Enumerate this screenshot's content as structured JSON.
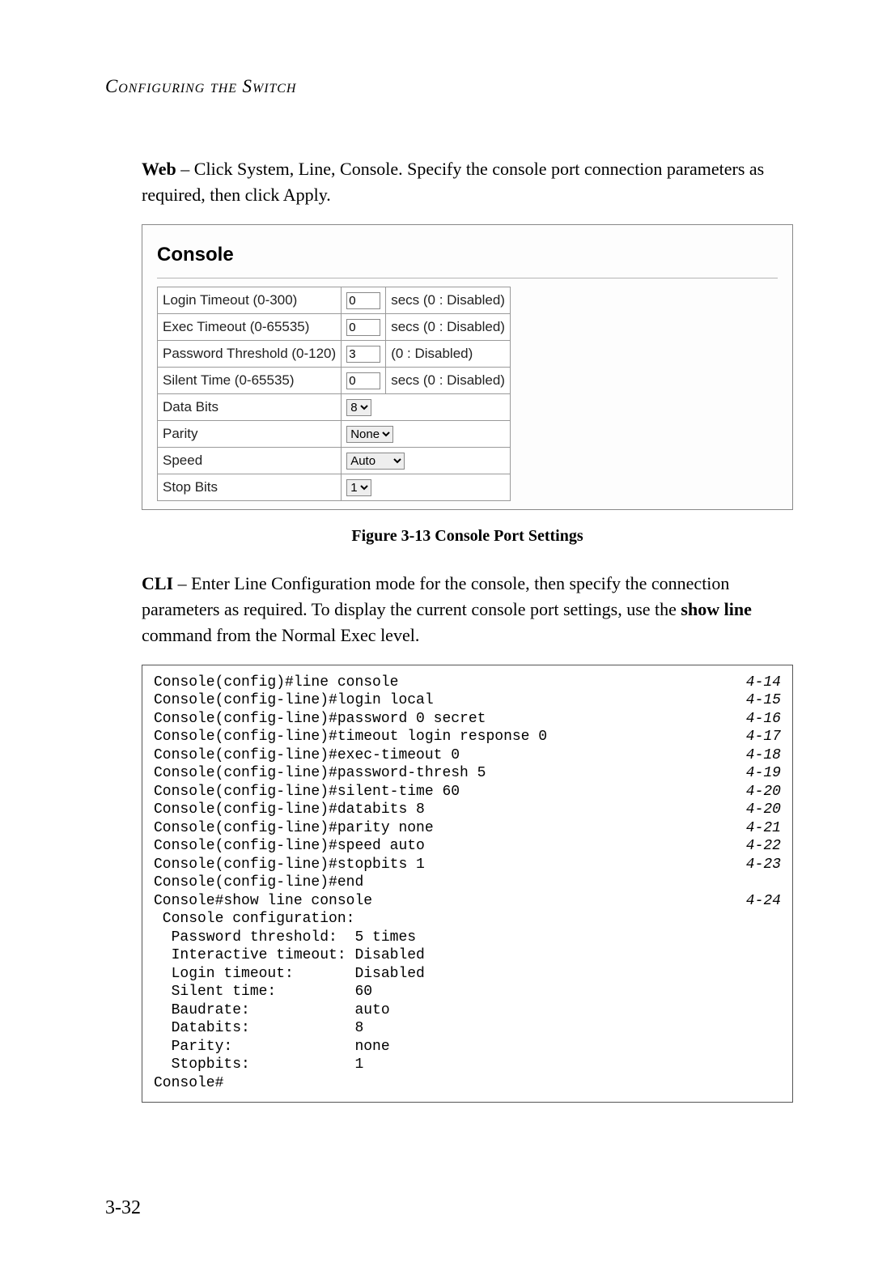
{
  "header": {
    "title": "Configuring the Switch"
  },
  "web_para": {
    "lead": "Web",
    "text": " – Click System, Line, Console. Specify the console port connection parameters as required, then click Apply."
  },
  "panel": {
    "title": "Console",
    "rows": [
      {
        "label": "Login Timeout (0-300)",
        "value": "0",
        "suffix": "secs (0 : Disabled)",
        "control": "text"
      },
      {
        "label": "Exec Timeout (0-65535)",
        "value": "0",
        "suffix": "secs (0 : Disabled)",
        "control": "text"
      },
      {
        "label": "Password Threshold (0-120)",
        "value": "3",
        "suffix": "(0 : Disabled)",
        "control": "text"
      },
      {
        "label": "Silent Time (0-65535)",
        "value": "0",
        "suffix": "secs (0 : Disabled)",
        "control": "text"
      },
      {
        "label": "Data Bits",
        "value": "8",
        "suffix": "",
        "control": "select"
      },
      {
        "label": "Parity",
        "value": "None",
        "suffix": "",
        "control": "select"
      },
      {
        "label": "Speed",
        "value": "Auto",
        "suffix": "",
        "control": "select"
      },
      {
        "label": "Stop Bits",
        "value": "1",
        "suffix": "",
        "control": "select"
      }
    ]
  },
  "figure_caption": "Figure 3-13  Console Port Settings",
  "cli_para": {
    "lead": "CLI",
    "part1": " – Enter Line Configuration mode for the console, then specify the connection parameters as required. To display the current console port settings, use the ",
    "strong": "show line",
    "part2": " command from the Normal Exec level."
  },
  "cli_lines": [
    {
      "cmd": "Console(config)#line console",
      "ref": "4-14"
    },
    {
      "cmd": "Console(config-line)#login local",
      "ref": "4-15"
    },
    {
      "cmd": "Console(config-line)#password 0 secret",
      "ref": "4-16"
    },
    {
      "cmd": "Console(config-line)#timeout login response 0",
      "ref": "4-17"
    },
    {
      "cmd": "Console(config-line)#exec-timeout 0",
      "ref": "4-18"
    },
    {
      "cmd": "Console(config-line)#password-thresh 5",
      "ref": "4-19"
    },
    {
      "cmd": "Console(config-line)#silent-time 60",
      "ref": "4-20"
    },
    {
      "cmd": "Console(config-line)#databits 8",
      "ref": "4-20"
    },
    {
      "cmd": "Console(config-line)#parity none",
      "ref": "4-21"
    },
    {
      "cmd": "Console(config-line)#speed auto",
      "ref": "4-22"
    },
    {
      "cmd": "Console(config-line)#stopbits 1",
      "ref": "4-23"
    },
    {
      "cmd": "Console(config-line)#end",
      "ref": ""
    },
    {
      "cmd": "Console#show line console",
      "ref": "4-24"
    },
    {
      "cmd": " Console configuration:",
      "ref": ""
    },
    {
      "cmd": "  Password threshold:  5 times",
      "ref": ""
    },
    {
      "cmd": "  Interactive timeout: Disabled",
      "ref": ""
    },
    {
      "cmd": "  Login timeout:       Disabled",
      "ref": ""
    },
    {
      "cmd": "  Silent time:         60",
      "ref": ""
    },
    {
      "cmd": "  Baudrate:            auto",
      "ref": ""
    },
    {
      "cmd": "  Databits:            8",
      "ref": ""
    },
    {
      "cmd": "  Parity:              none",
      "ref": ""
    },
    {
      "cmd": "  Stopbits:            1",
      "ref": ""
    },
    {
      "cmd": "Console#",
      "ref": ""
    }
  ],
  "page_number": "3-32"
}
